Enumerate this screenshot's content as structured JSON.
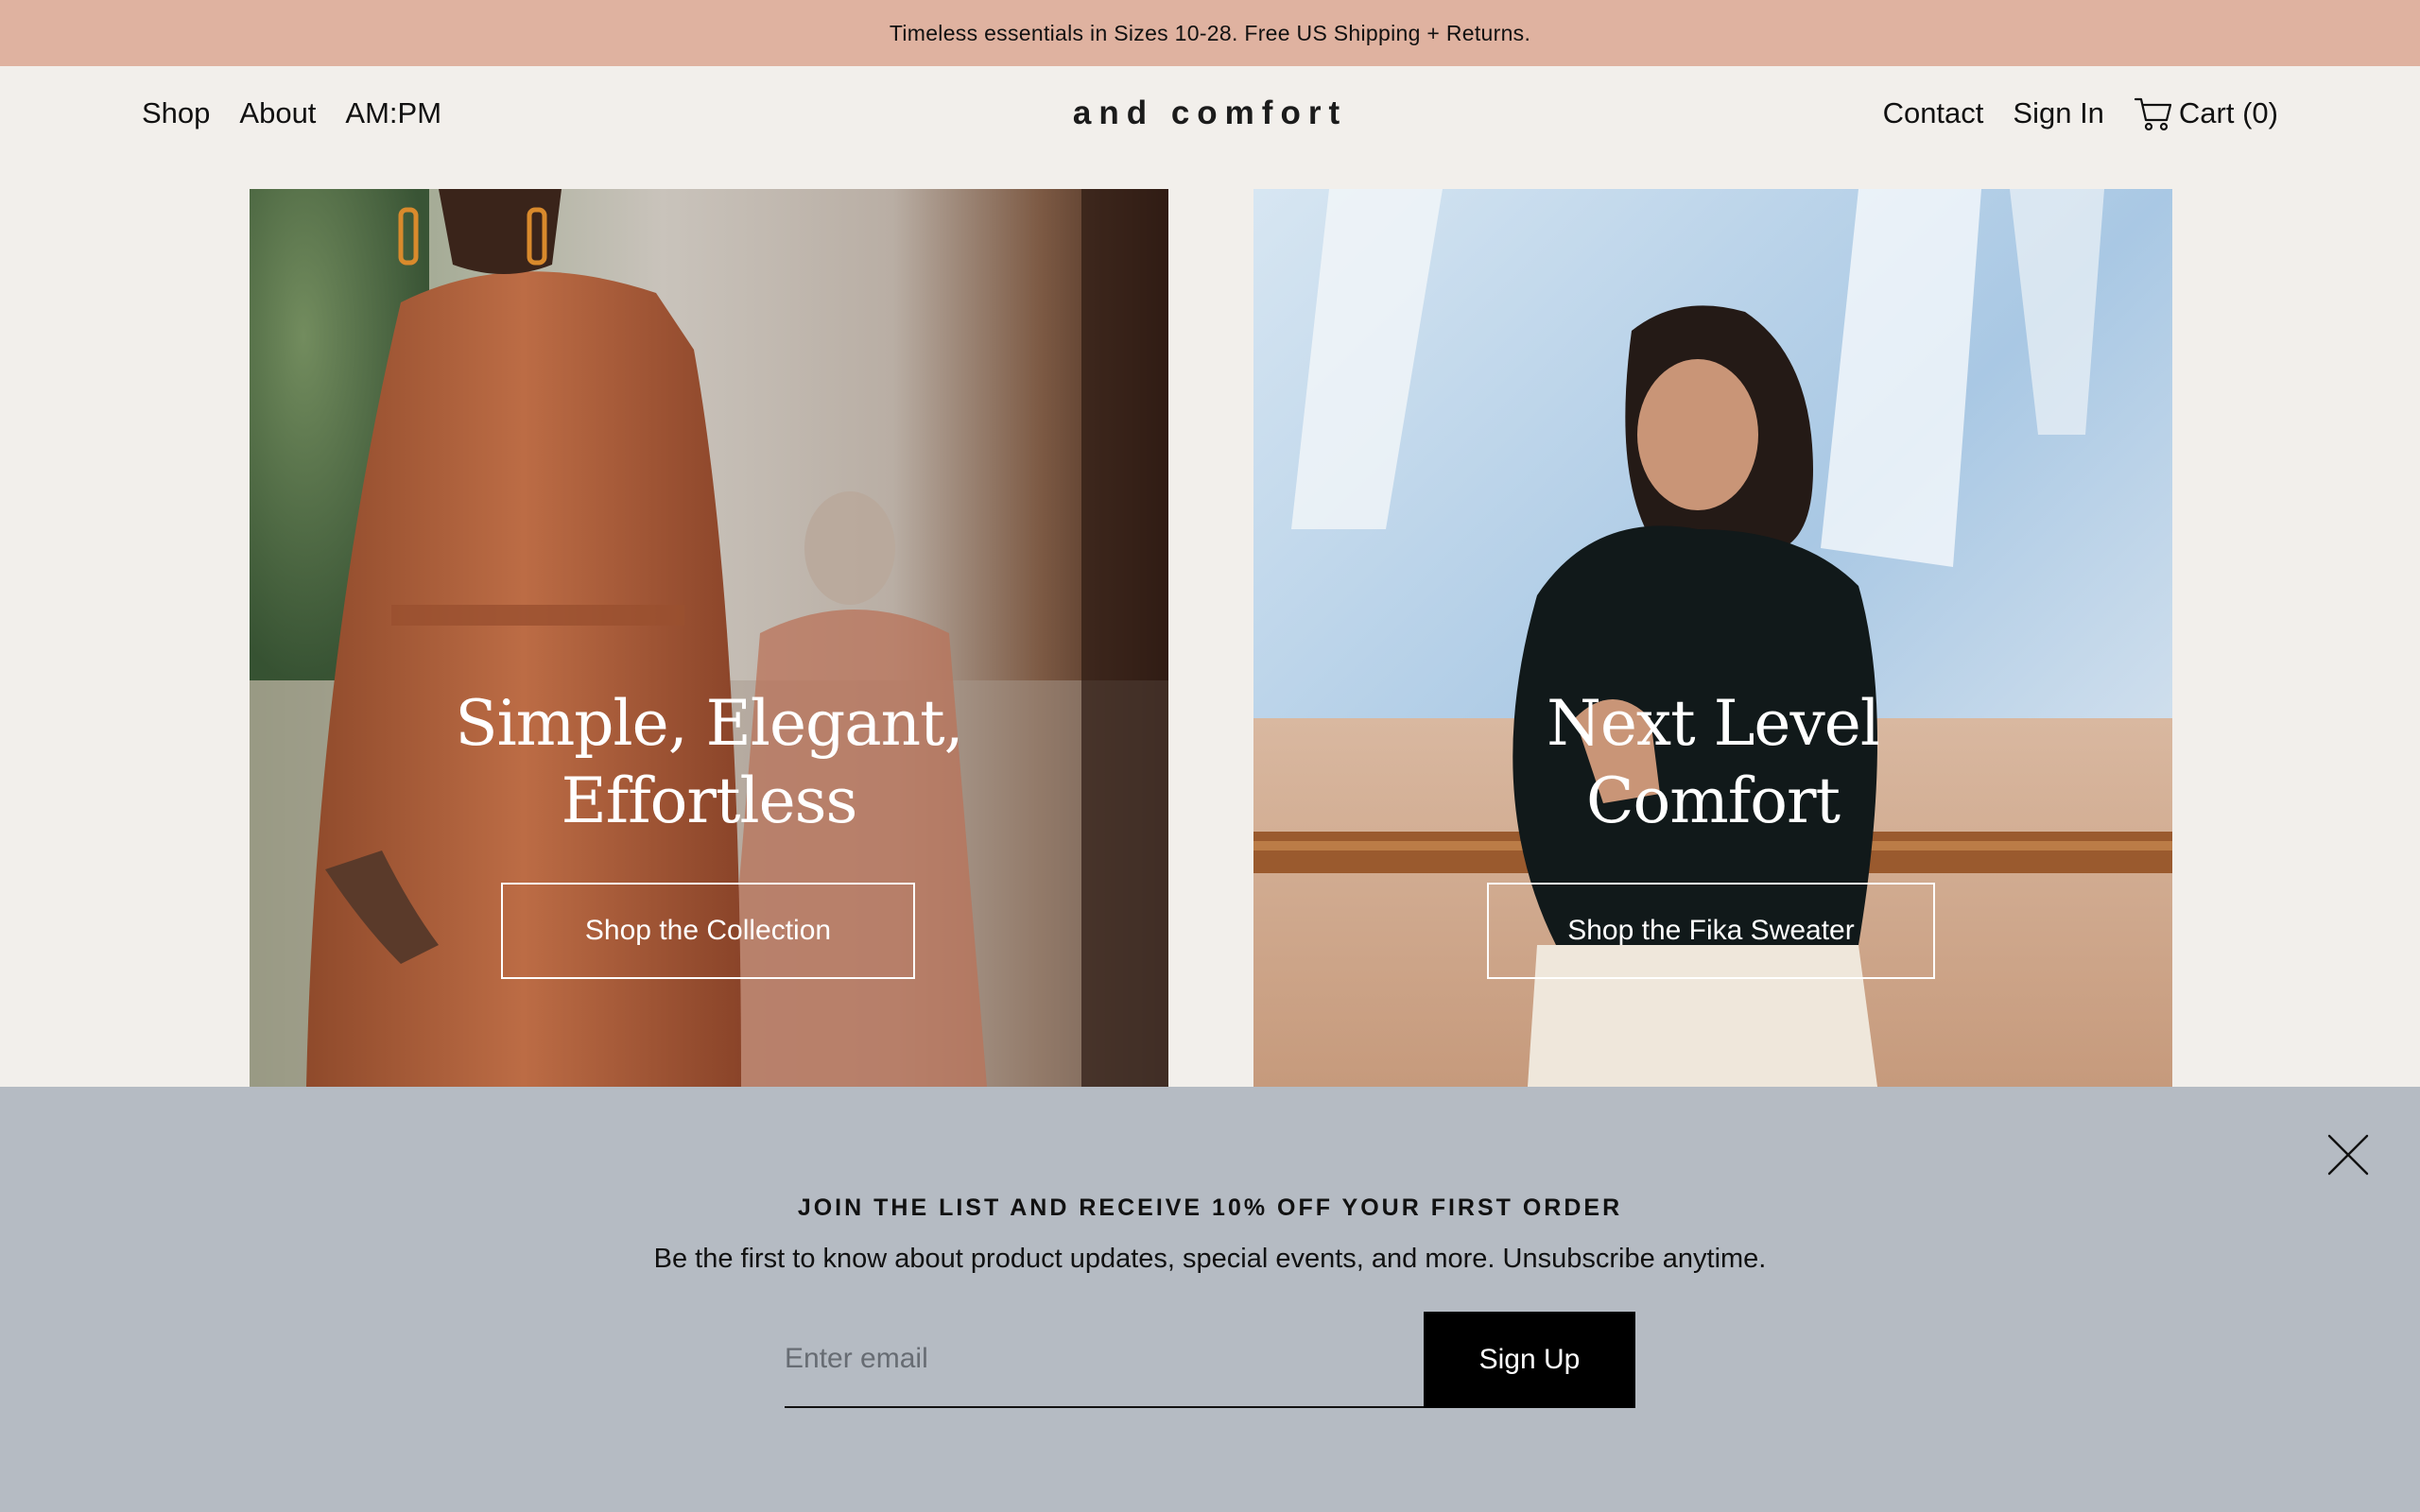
{
  "announcement": "Timeless essentials in Sizes 10-28. Free US Shipping + Returns.",
  "nav_left": [
    "Shop",
    "About",
    "AM:PM"
  ],
  "logo": "and comfort",
  "nav_right": {
    "contact": "Contact",
    "sign_in": "Sign In",
    "cart": "Cart (0)"
  },
  "hero": [
    {
      "line1": "Simple, Elegant,",
      "line2": "Effortless",
      "button": "Shop the Collection"
    },
    {
      "line1": "Next Level",
      "line2": "Comfort",
      "button": "Shop the Fika Sweater"
    }
  ],
  "newsletter": {
    "title": "JOIN THE LIST AND RECEIVE 10% OFF YOUR FIRST ORDER",
    "subtitle": "Be the first to know about product updates, special events, and more. Unsubscribe anytime.",
    "email_placeholder": "Enter email",
    "button": "Sign Up"
  },
  "colors": {
    "announcement_bg": "#dfb2a0",
    "page_bg": "#f2efeb",
    "newsletter_bg": "#b5bbc3",
    "button_bg": "#000000"
  }
}
